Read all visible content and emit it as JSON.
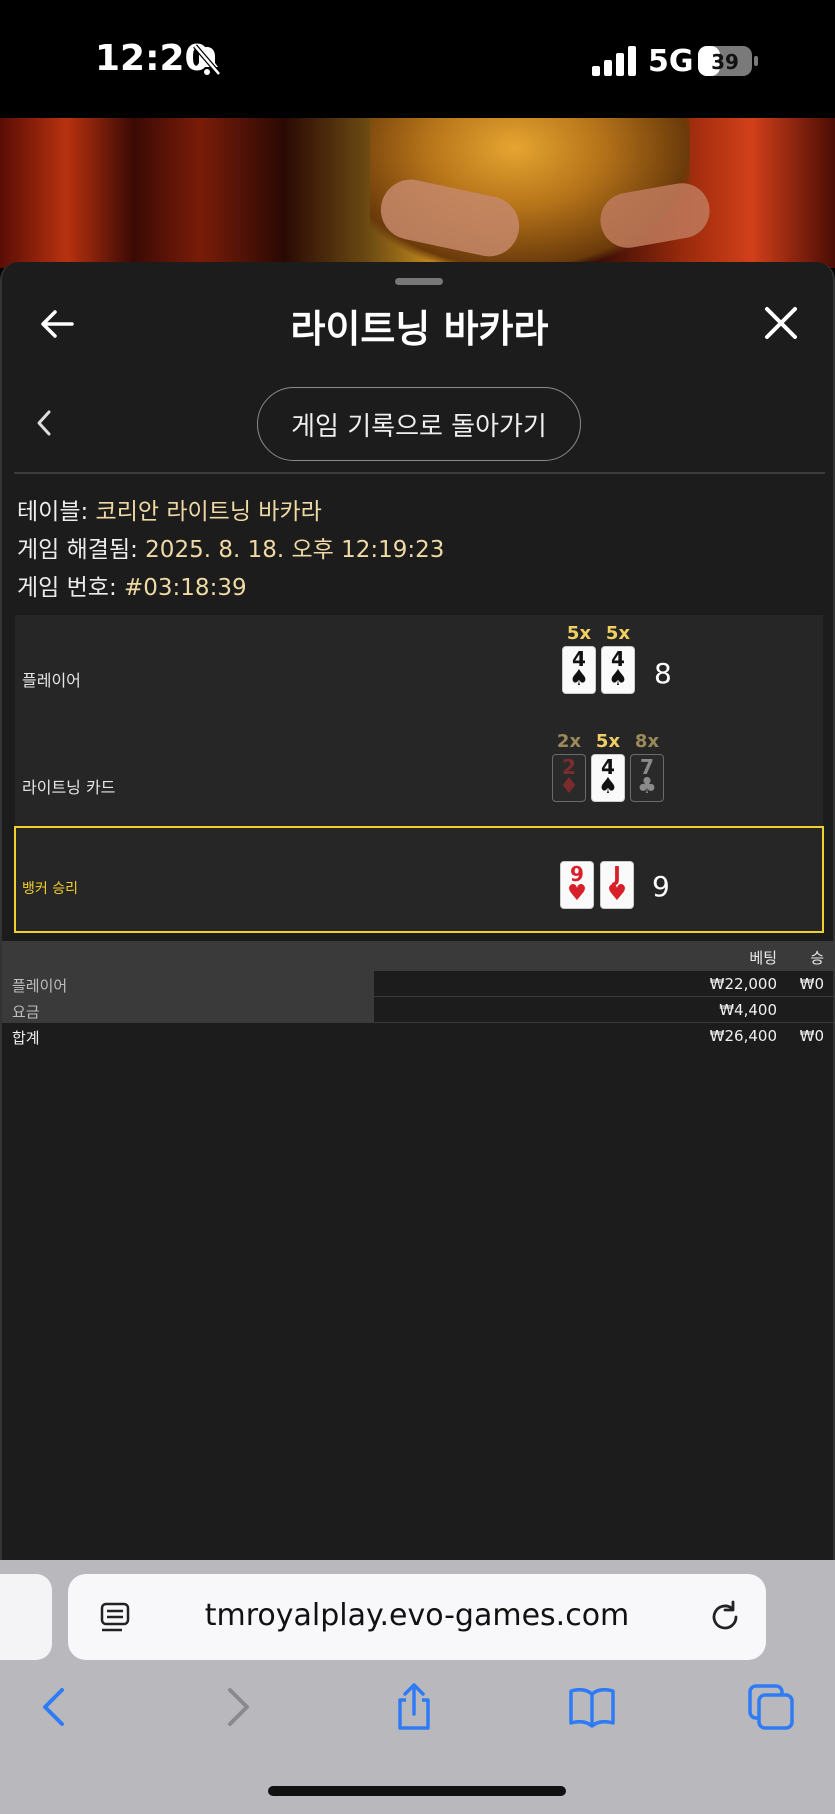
{
  "status_bar": {
    "time": "12:20",
    "network": "5G",
    "battery": "39"
  },
  "header": {
    "title": "라이트닝 바카라"
  },
  "nav": {
    "back_to_history": "게임 기록으로 돌아가기"
  },
  "info": {
    "table_label": "테이블: ",
    "table_value": "코리안 라이트닝 바카라",
    "resolved_label": "게임 해결됨: ",
    "resolved_value": "2025. 8. 18. 오후 12:19:23",
    "number_label": "게임 번호: ",
    "number_value": "#03:18:39"
  },
  "results": {
    "player": {
      "label": "플레이어",
      "score": "8",
      "cards": [
        {
          "rank": "4",
          "suit": "♠",
          "color": "black",
          "mult": "5x"
        },
        {
          "rank": "4",
          "suit": "♠",
          "color": "black",
          "mult": "5x"
        }
      ]
    },
    "lightning": {
      "label": "라이트닝 카드",
      "cards": [
        {
          "rank": "2",
          "suit": "♦",
          "color": "red",
          "mult": "2x",
          "dim": true
        },
        {
          "rank": "4",
          "suit": "♠",
          "color": "black",
          "mult": "5x",
          "dim": false
        },
        {
          "rank": "7",
          "suit": "♣",
          "color": "black",
          "mult": "8x",
          "dim": true
        }
      ]
    },
    "banker": {
      "label": "뱅커 승리",
      "score": "9",
      "cards": [
        {
          "rank": "9",
          "suit": "♥",
          "color": "red"
        },
        {
          "rank": "J",
          "suit": "♥",
          "color": "red"
        }
      ]
    }
  },
  "bets": {
    "headers": {
      "bet": "베팅",
      "win": "승"
    },
    "rows": [
      {
        "name": "플레이어",
        "amount": "₩22,000",
        "win": "₩0"
      },
      {
        "name": "요금",
        "amount": "₩4,400",
        "win": ""
      },
      {
        "name": "합계",
        "amount": "₩26,400",
        "win": "₩0"
      }
    ]
  },
  "browser": {
    "url": "tmroyalplay.evo-games.com"
  },
  "colors": {
    "accent_gold": "#f1cf2c",
    "panel": "#1c1c1c",
    "value_text": "#efd9a4"
  }
}
